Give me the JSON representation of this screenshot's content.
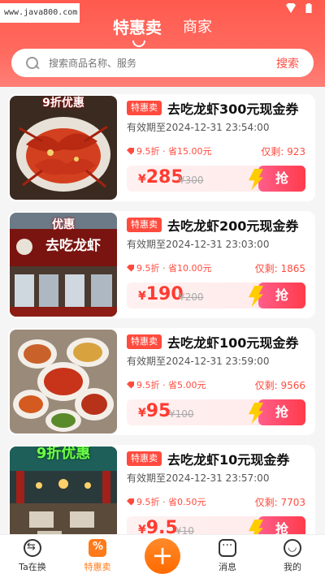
{
  "watermark": "www.java800.com",
  "top_tabs": [
    {
      "label": "特惠卖",
      "active": true
    },
    {
      "label": "商家",
      "active": false
    }
  ],
  "search": {
    "placeholder": "搜索商品名称、服务",
    "button_label": "搜索"
  },
  "products": [
    {
      "badge": "特惠卖",
      "title": "去吃龙虾300元现金券",
      "validity": "有效期至2024-12-31 23:54:00",
      "discount": "9.5折 · 省15.00元",
      "stock_label": "仅剩:",
      "stock": "923",
      "currency": "¥",
      "price": "285",
      "original_price": "¥300",
      "grab_label": "抢",
      "thumb_caption": "9折优惠"
    },
    {
      "badge": "特惠卖",
      "title": "去吃龙虾200元现金券",
      "validity": "有效期至2024-12-31 23:03:00",
      "discount": "9.5折 · 省10.00元",
      "stock_label": "仅剩:",
      "stock": "1865",
      "currency": "¥",
      "price": "190",
      "original_price": "¥200",
      "grab_label": "抢",
      "thumb_caption": "优惠",
      "thumb_sign": "去吃龙虾"
    },
    {
      "badge": "特惠卖",
      "title": "去吃龙虾100元现金券",
      "validity": "有效期至2024-12-31 23:59:00",
      "discount": "9.5折 · 省5.00元",
      "stock_label": "仅剩:",
      "stock": "9566",
      "currency": "¥",
      "price": "95",
      "original_price": "¥100",
      "grab_label": "抢",
      "thumb_caption": ""
    },
    {
      "badge": "特惠卖",
      "title": "去吃龙虾10元现金券",
      "validity": "有效期至2024-12-31 23:57:00",
      "discount": "9.5折 · 省0.50元",
      "stock_label": "仅剩:",
      "stock": "7703",
      "currency": "¥",
      "price": "9.5",
      "original_price": "¥10",
      "grab_label": "抢",
      "thumb_caption": "9折优惠"
    }
  ],
  "tabbar": [
    {
      "label": "Ta在换",
      "icon": "swap-icon"
    },
    {
      "label": "特惠卖",
      "icon": "coupon-icon",
      "active": true
    },
    {
      "label": "",
      "icon": "plus-icon"
    },
    {
      "label": "消息",
      "icon": "message-icon"
    },
    {
      "label": "我的",
      "icon": "profile-icon"
    }
  ]
}
